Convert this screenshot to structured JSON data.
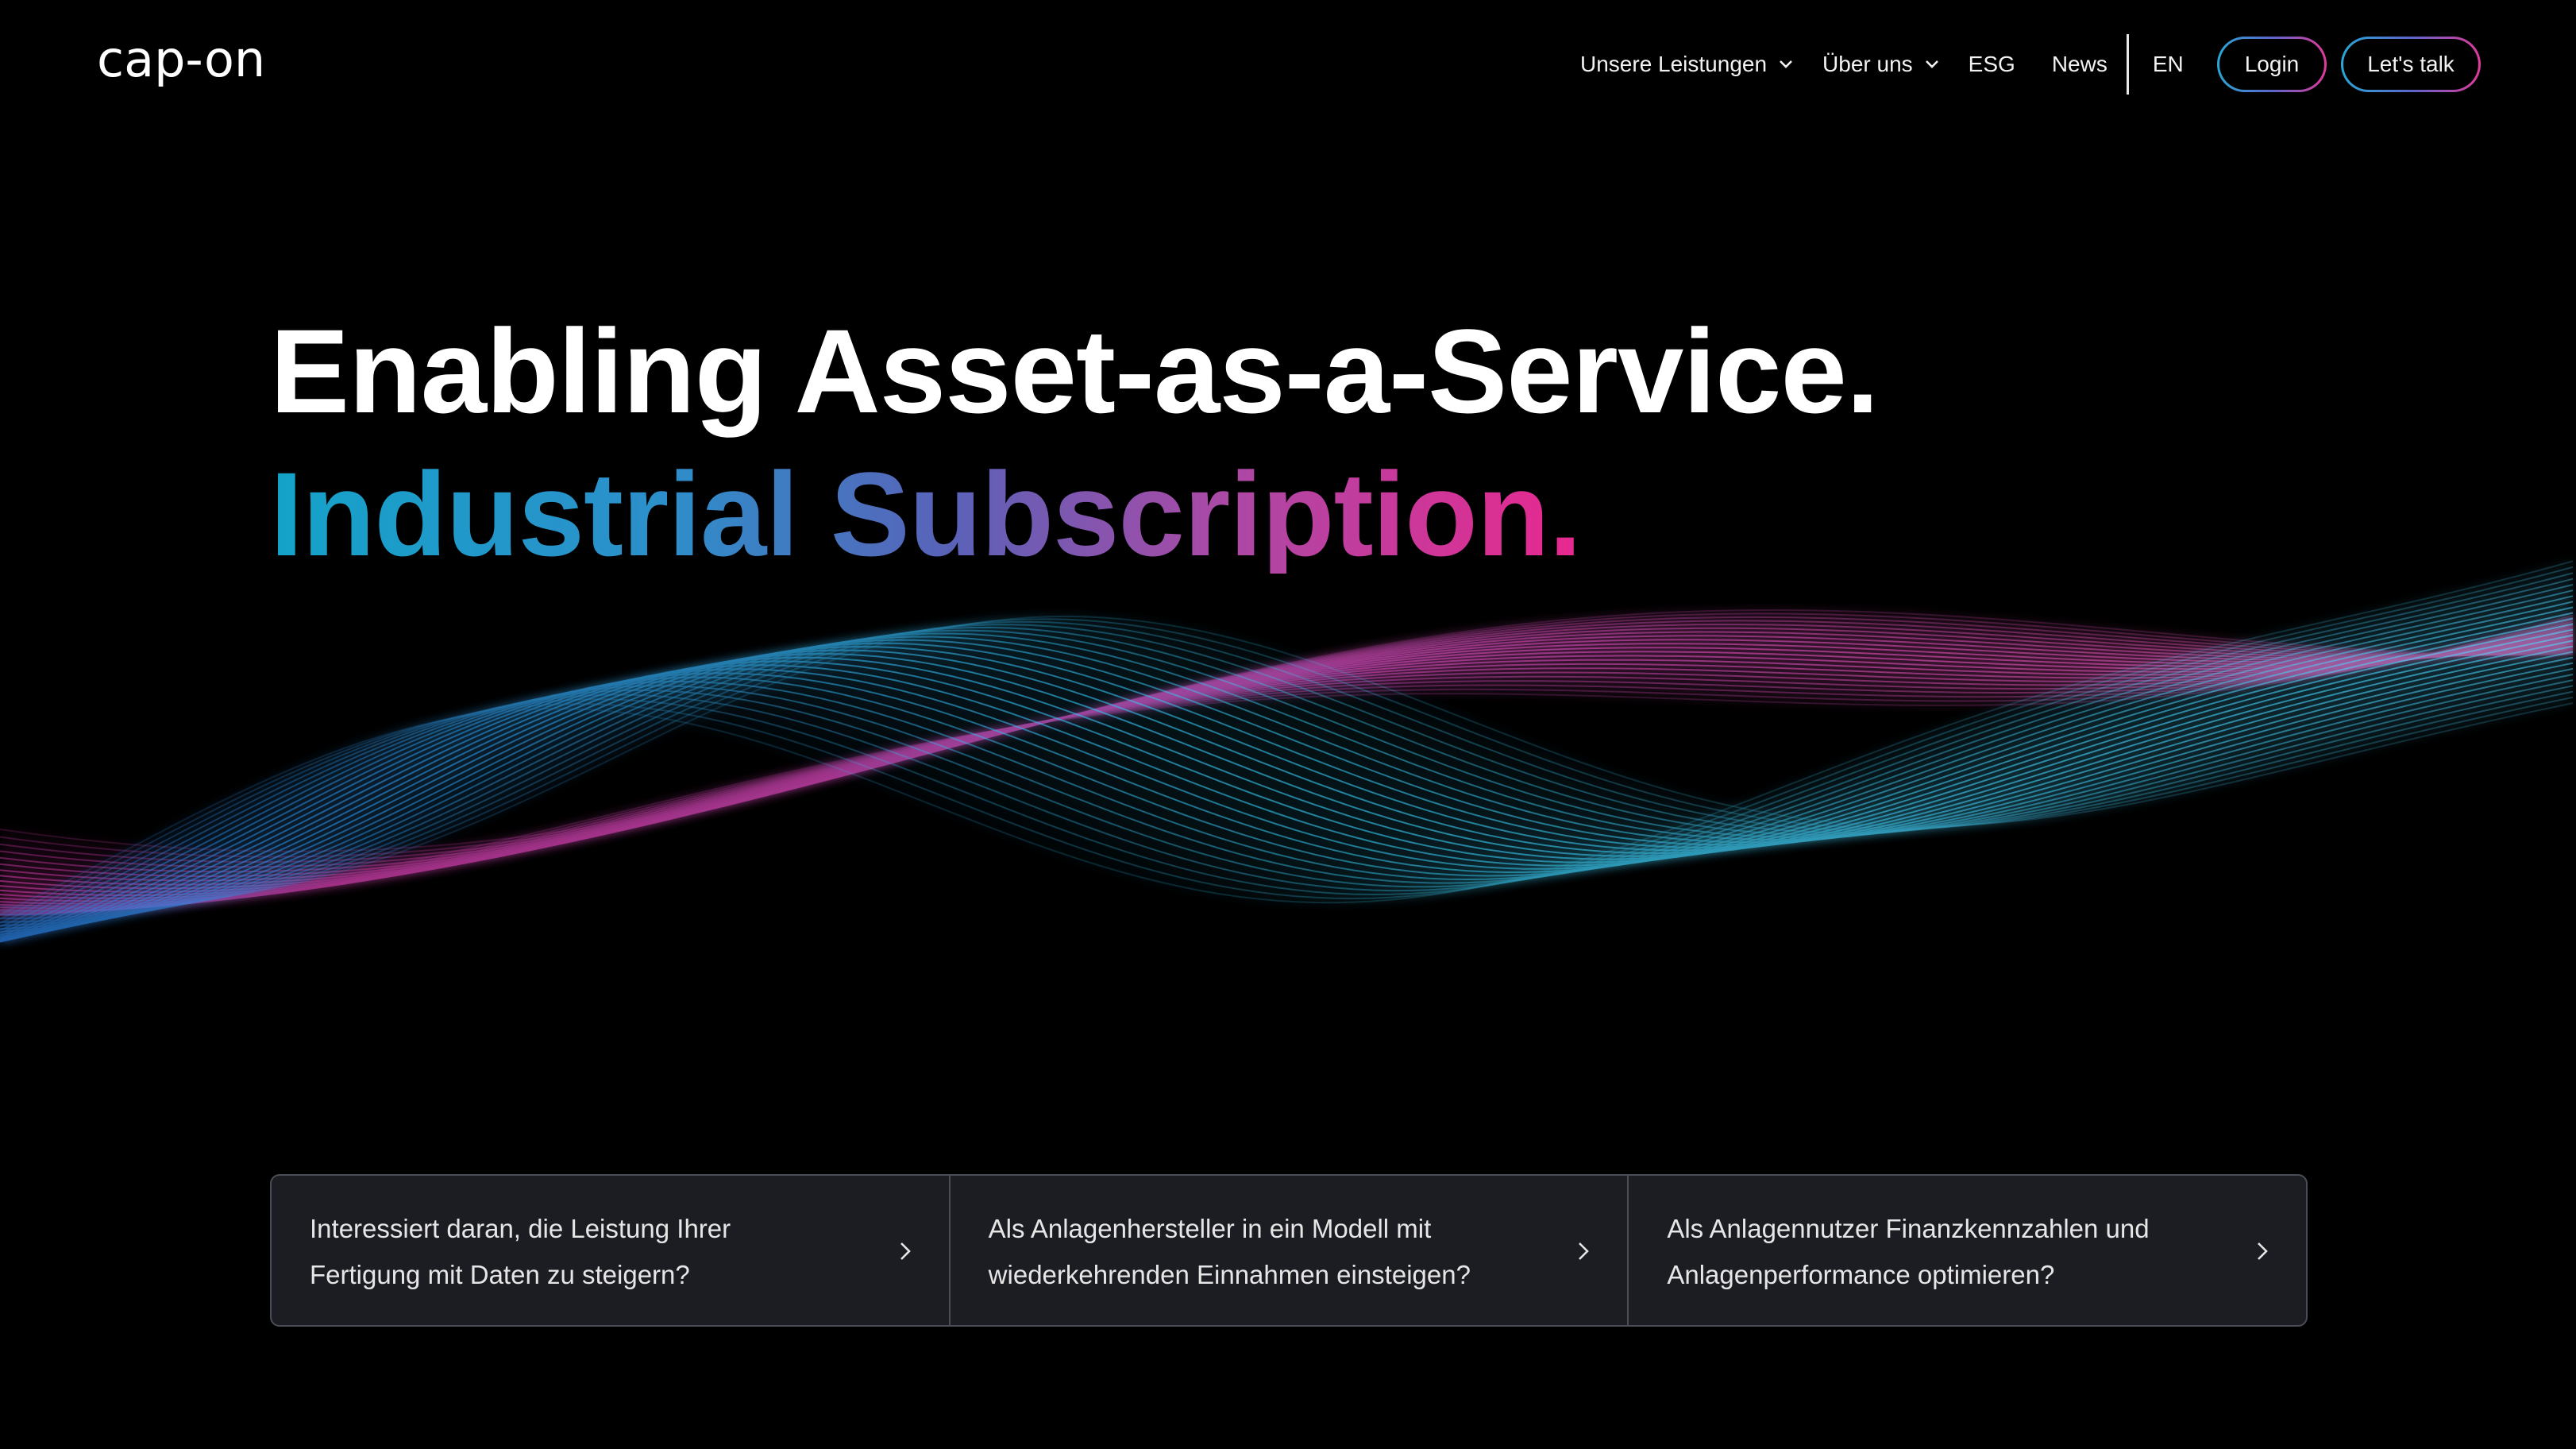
{
  "brand": {
    "logo_text": "cap-on",
    "colors": {
      "background": "#000000",
      "accent_blue": "#14a3c9",
      "accent_violet": "#5a62b8",
      "accent_pink": "#e8288f"
    }
  },
  "nav": {
    "items": [
      {
        "label": "Unsere Leistungen",
        "has_dropdown": true
      },
      {
        "label": "Über uns",
        "has_dropdown": true
      },
      {
        "label": "ESG",
        "has_dropdown": false
      },
      {
        "label": "News",
        "has_dropdown": false
      }
    ],
    "language": "EN",
    "login_label": "Login",
    "cta_label": "Let's talk"
  },
  "hero": {
    "title": "Enabling Asset-as-a-Service.",
    "subtitle": "Industrial Subscription."
  },
  "cards": [
    {
      "text": "Interessiert daran, die Leistung Ihrer Fertigung mit Daten zu steigern?",
      "icon": "chevron-right-icon"
    },
    {
      "text": "Als Anlagenhersteller in ein Modell mit wiederkehrenden Einnahmen einsteigen?",
      "icon": "chevron-right-icon"
    },
    {
      "text": "Als Anlagennutzer Finanzkennzahlen und Anlagenperformance optimieren?",
      "icon": "chevron-right-icon"
    }
  ]
}
